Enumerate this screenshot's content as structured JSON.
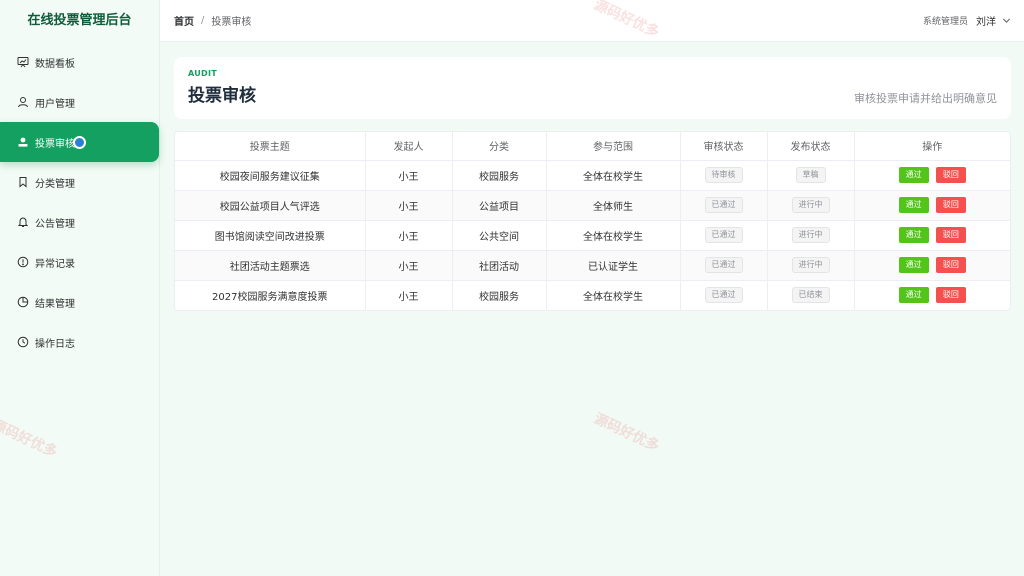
{
  "app": {
    "title": "在线投票管理后台"
  },
  "sidebar": {
    "items": [
      {
        "label": "数据看板",
        "icon": "dashboard-icon"
      },
      {
        "label": "用户管理",
        "icon": "user-icon"
      },
      {
        "label": "投票审核",
        "icon": "upload-icon",
        "active": true
      },
      {
        "label": "分类管理",
        "icon": "bookmark-icon"
      },
      {
        "label": "公告管理",
        "icon": "bell-icon"
      },
      {
        "label": "异常记录",
        "icon": "alert-icon"
      },
      {
        "label": "结果管理",
        "icon": "pie-icon"
      },
      {
        "label": "操作日志",
        "icon": "clock-icon"
      }
    ]
  },
  "header": {
    "breadcrumb": {
      "home": "首页",
      "sep": "/",
      "current": "投票审核"
    },
    "user": {
      "role": "系统管理员",
      "name": "刘洋"
    }
  },
  "page": {
    "eyebrow": "AUDIT",
    "title": "投票审核",
    "description": "审核投票申请并给出明确意见"
  },
  "table": {
    "headers": [
      "投票主题",
      "发起人",
      "分类",
      "参与范围",
      "审核状态",
      "发布状态",
      "操作"
    ],
    "actions": {
      "pass": "通过",
      "reject": "驳回"
    },
    "rows": [
      {
        "topic": "校园夜间服务建议征集",
        "initiator": "小王",
        "category": "校园服务",
        "scope": "全体在校学生",
        "audit": "待审核",
        "publish": "草稿"
      },
      {
        "topic": "校园公益项目人气评选",
        "initiator": "小王",
        "category": "公益项目",
        "scope": "全体师生",
        "audit": "已通过",
        "publish": "进行中"
      },
      {
        "topic": "图书馆阅读空间改进投票",
        "initiator": "小王",
        "category": "公共空间",
        "scope": "全体在校学生",
        "audit": "已通过",
        "publish": "进行中"
      },
      {
        "topic": "社团活动主题票选",
        "initiator": "小王",
        "category": "社团活动",
        "scope": "已认证学生",
        "audit": "已通过",
        "publish": "进行中"
      },
      {
        "topic": "2027校园服务满意度投票",
        "initiator": "小王",
        "category": "校园服务",
        "scope": "全体在校学生",
        "audit": "已通过",
        "publish": "已结束"
      }
    ]
  },
  "watermark": "源码好优多",
  "colors": {
    "accent": "#13a060",
    "pass": "#52c41a",
    "reject": "#f5504f"
  }
}
